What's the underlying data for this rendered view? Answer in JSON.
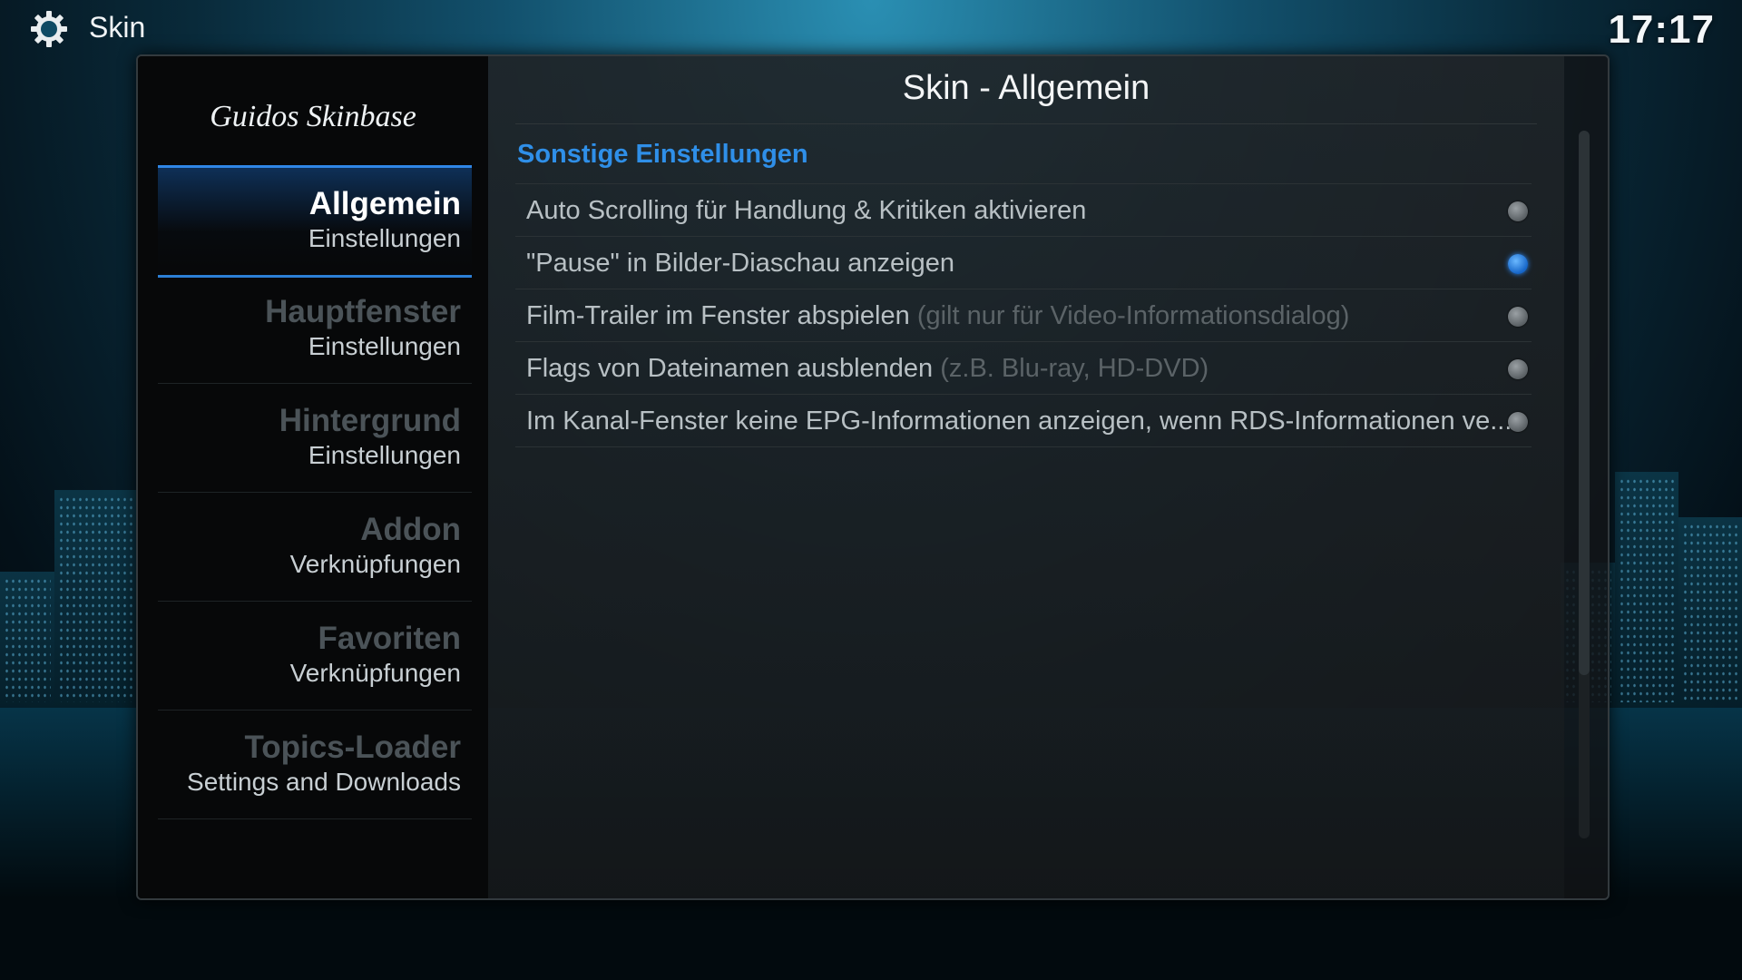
{
  "header": {
    "app_title": "Skin",
    "clock": "17:17",
    "icon": "gear-icon"
  },
  "sidebar": {
    "brand": "Guidos Skinbase",
    "items": [
      {
        "title": "Allgemein",
        "subtitle": "Einstellungen",
        "active": true
      },
      {
        "title": "Hauptfenster",
        "subtitle": "Einstellungen",
        "active": false
      },
      {
        "title": "Hintergrund",
        "subtitle": "Einstellungen",
        "active": false
      },
      {
        "title": "Addon",
        "subtitle": "Verknüpfungen",
        "active": false
      },
      {
        "title": "Favoriten",
        "subtitle": "Verknüpfungen",
        "active": false
      },
      {
        "title": "Topics-Loader",
        "subtitle": "Settings and Downloads",
        "active": false
      }
    ]
  },
  "main": {
    "title": "Skin - Allgemein",
    "section": "Sonstige Einstellungen",
    "settings": [
      {
        "label": "Auto Scrolling für Handlung & Kritiken aktivieren",
        "hint": "",
        "enabled": false
      },
      {
        "label": "\"Pause\" in Bilder-Diaschau anzeigen",
        "hint": "",
        "enabled": true
      },
      {
        "label": "Film-Trailer im Fenster abspielen",
        "hint": "(gilt nur für Video-Informationsdialog)",
        "enabled": false
      },
      {
        "label": "Flags von Dateinamen ausblenden",
        "hint": "(z.B. Blu-ray, HD-DVD)",
        "enabled": false
      },
      {
        "label": "Im Kanal-Fenster keine EPG-Informationen anzeigen, wenn RDS-Informationen ve...",
        "hint": "",
        "enabled": false
      }
    ]
  },
  "colors": {
    "accent": "#2f8fe8",
    "radio_on": "#1565c8",
    "radio_off": "#7a8084"
  }
}
